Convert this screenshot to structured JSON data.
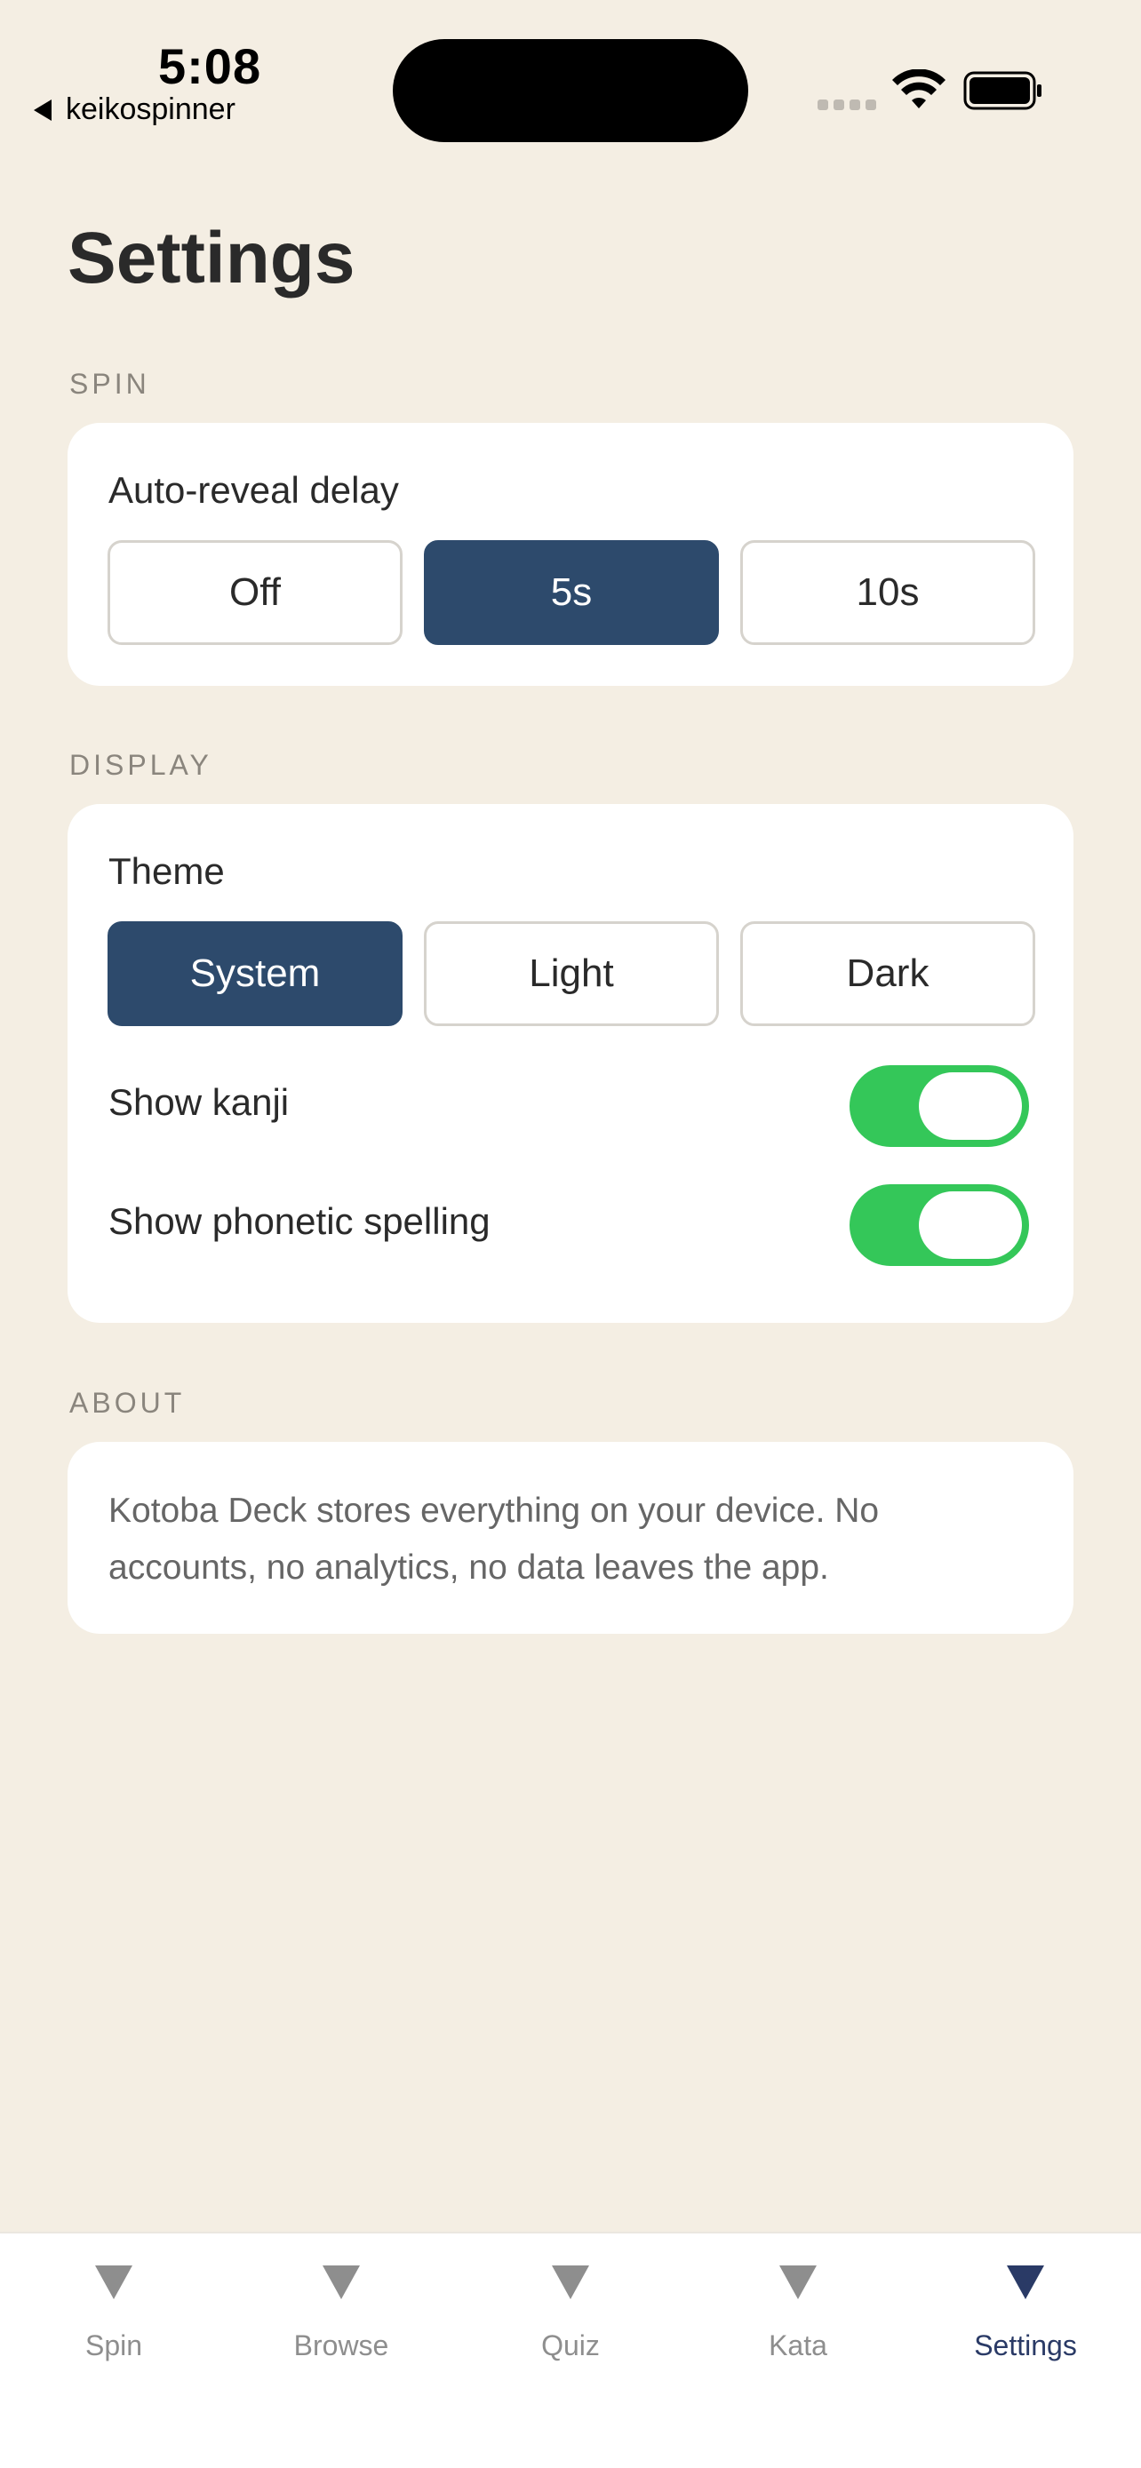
{
  "status_bar": {
    "time": "5:08",
    "back_app": "keikospinner"
  },
  "page": {
    "title": "Settings"
  },
  "spin_section": {
    "header": "SPIN",
    "auto_reveal_label": "Auto-reveal delay",
    "options": [
      "Off",
      "5s",
      "10s"
    ],
    "selected": "5s"
  },
  "display_section": {
    "header": "DISPLAY",
    "theme_label": "Theme",
    "theme_options": [
      "System",
      "Light",
      "Dark"
    ],
    "theme_selected": "System",
    "show_kanji_label": "Show kanji",
    "show_kanji_on": true,
    "show_phonetic_label": "Show phonetic spelling",
    "show_phonetic_on": true
  },
  "about_section": {
    "header": "ABOUT",
    "text": "Kotoba Deck stores everything on your device. No accounts, no analytics, no data leaves the app."
  },
  "tab_bar": {
    "tabs": [
      "Spin",
      "Browse",
      "Quiz",
      "Kata",
      "Settings"
    ],
    "active": "Settings"
  },
  "colors": {
    "background": "#f4eee3",
    "accent_selected": "#2d4a6c",
    "toggle_on": "#34c759",
    "tab_active": "#2a3a66",
    "tab_inactive": "#8e8e8e"
  },
  "icons": {
    "tab_icon": "triangle-down-icon"
  }
}
